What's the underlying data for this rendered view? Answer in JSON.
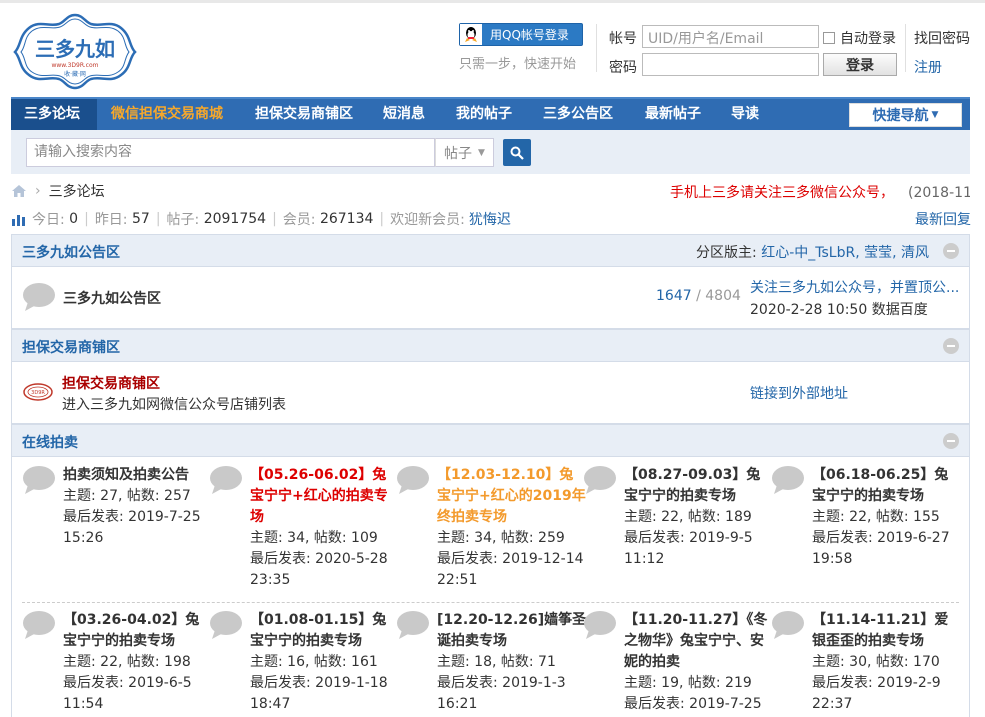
{
  "logo": {
    "name": "三多九如",
    "url_text": "www.3D9R.com",
    "sub": "收·藏·网"
  },
  "login": {
    "qq_button": "用QQ帐号登录",
    "qq_tip": "只需一步，快速开始",
    "account_label": "帐号",
    "account_placeholder": "UID/用户名/Email",
    "password_label": "密码",
    "auto_login": "自动登录",
    "login_button": "登录",
    "forgot": "找回密码",
    "register": "注册"
  },
  "nav": {
    "items": [
      "三多论坛",
      "微信担保交易商城",
      "担保交易商铺区",
      "短消息",
      "我的帖子",
      "三多公告区",
      "最新帖子",
      "导读"
    ],
    "quick": "快捷导航"
  },
  "search": {
    "placeholder": "请输入搜索内容",
    "type": "帖子"
  },
  "breadcrumb": {
    "current": "三多论坛"
  },
  "marquee": {
    "text": "手机上三多请关注三多微信公众号，",
    "date": "(2018-11-"
  },
  "stats": {
    "today_label": "今日:",
    "today": "0",
    "yesterday_label": "昨日:",
    "yesterday": "57",
    "posts_label": "帖子:",
    "posts": "2091754",
    "members_label": "会员:",
    "members": "267134",
    "welcome_label": "欢迎新会员:",
    "new_member": "犹悔迟",
    "latest_reply": "最新回复"
  },
  "sections": {
    "announce": {
      "title": "三多九如公告区",
      "moderators_label": "分区版主:",
      "moderators": "红心-中_TsLbR, 莹莹, 清风",
      "forum_name": "三多九如公告区",
      "threads": "1647",
      "slash": "/",
      "posts": "4804",
      "last_title": "关注三多九如公众号，并置顶公...",
      "last_time": "2020-2-28 10:50 数据百度"
    },
    "shop": {
      "title": "担保交易商铺区",
      "forum_name": "担保交易商铺区",
      "desc": "进入三多九如网微信公众号店铺列表",
      "link": "链接到外部地址"
    },
    "auction": {
      "title": "在线拍卖",
      "row1": [
        {
          "title": "拍卖须知及拍卖公告",
          "color": "#333333",
          "stats": "主题: 27, 帖数: 257",
          "last": "最后发表: 2019-7-25 15:26"
        },
        {
          "title": "【05.26-06.02】兔宝宁宁+红心的拍卖专场",
          "color": "#dd0000",
          "stats": "主题: 34, 帖数: 109",
          "last": "最后发表: 2020-5-28 23:35"
        },
        {
          "title": "【12.03-12.10】兔宝宁宁+红心的2019年终拍卖专场",
          "color": "#f39a2c",
          "stats": "主题: 34, 帖数: 259",
          "last": "最后发表: 2019-12-14 22:51"
        },
        {
          "title": "【08.27-09.03】兔宝宁宁的拍卖专场",
          "color": "#333333",
          "stats": "主题: 22, 帖数: 189",
          "last": "最后发表: 2019-9-5 11:12"
        },
        {
          "title": "【06.18-06.25】兔宝宁宁的拍卖专场",
          "color": "#333333",
          "stats": "主题: 22, 帖数: 155",
          "last": "最后发表: 2019-6-27 19:58"
        }
      ],
      "row2": [
        {
          "title": "【03.26-04.02】兔宝宁宁的拍卖专场",
          "color": "#333333",
          "stats": "主题: 22, 帖数: 198",
          "last": "最后发表: 2019-6-5 11:54"
        },
        {
          "title": "【01.08-01.15】兔宝宁宁的拍卖专场",
          "color": "#333333",
          "stats": "主题: 16, 帖数: 161",
          "last": "最后发表: 2019-1-18 18:47"
        },
        {
          "title": "[12.20-12.26]嫱筝圣诞拍卖专场",
          "color": "#333333",
          "stats": "主题: 18, 帖数: 71",
          "last": "最后发表: 2019-1-3 16:21"
        },
        {
          "title": "【11.20-11.27】《冬之物华》兔宝宁宁、安妮的拍卖",
          "color": "#333333",
          "stats": "主题: 19, 帖数: 219",
          "last": "最后发表: 2019-7-25"
        },
        {
          "title": "【11.14-11.21】爱银歪歪的拍卖专场",
          "color": "#333333",
          "stats": "主题: 30, 帖数: 170",
          "last": "最后发表: 2019-2-9 22:37"
        }
      ]
    }
  },
  "colors": {
    "nav_bg": "#2f6cb3",
    "link": "#2366a8",
    "accent_red": "#dd0000",
    "accent_orange": "#f39a2c"
  }
}
